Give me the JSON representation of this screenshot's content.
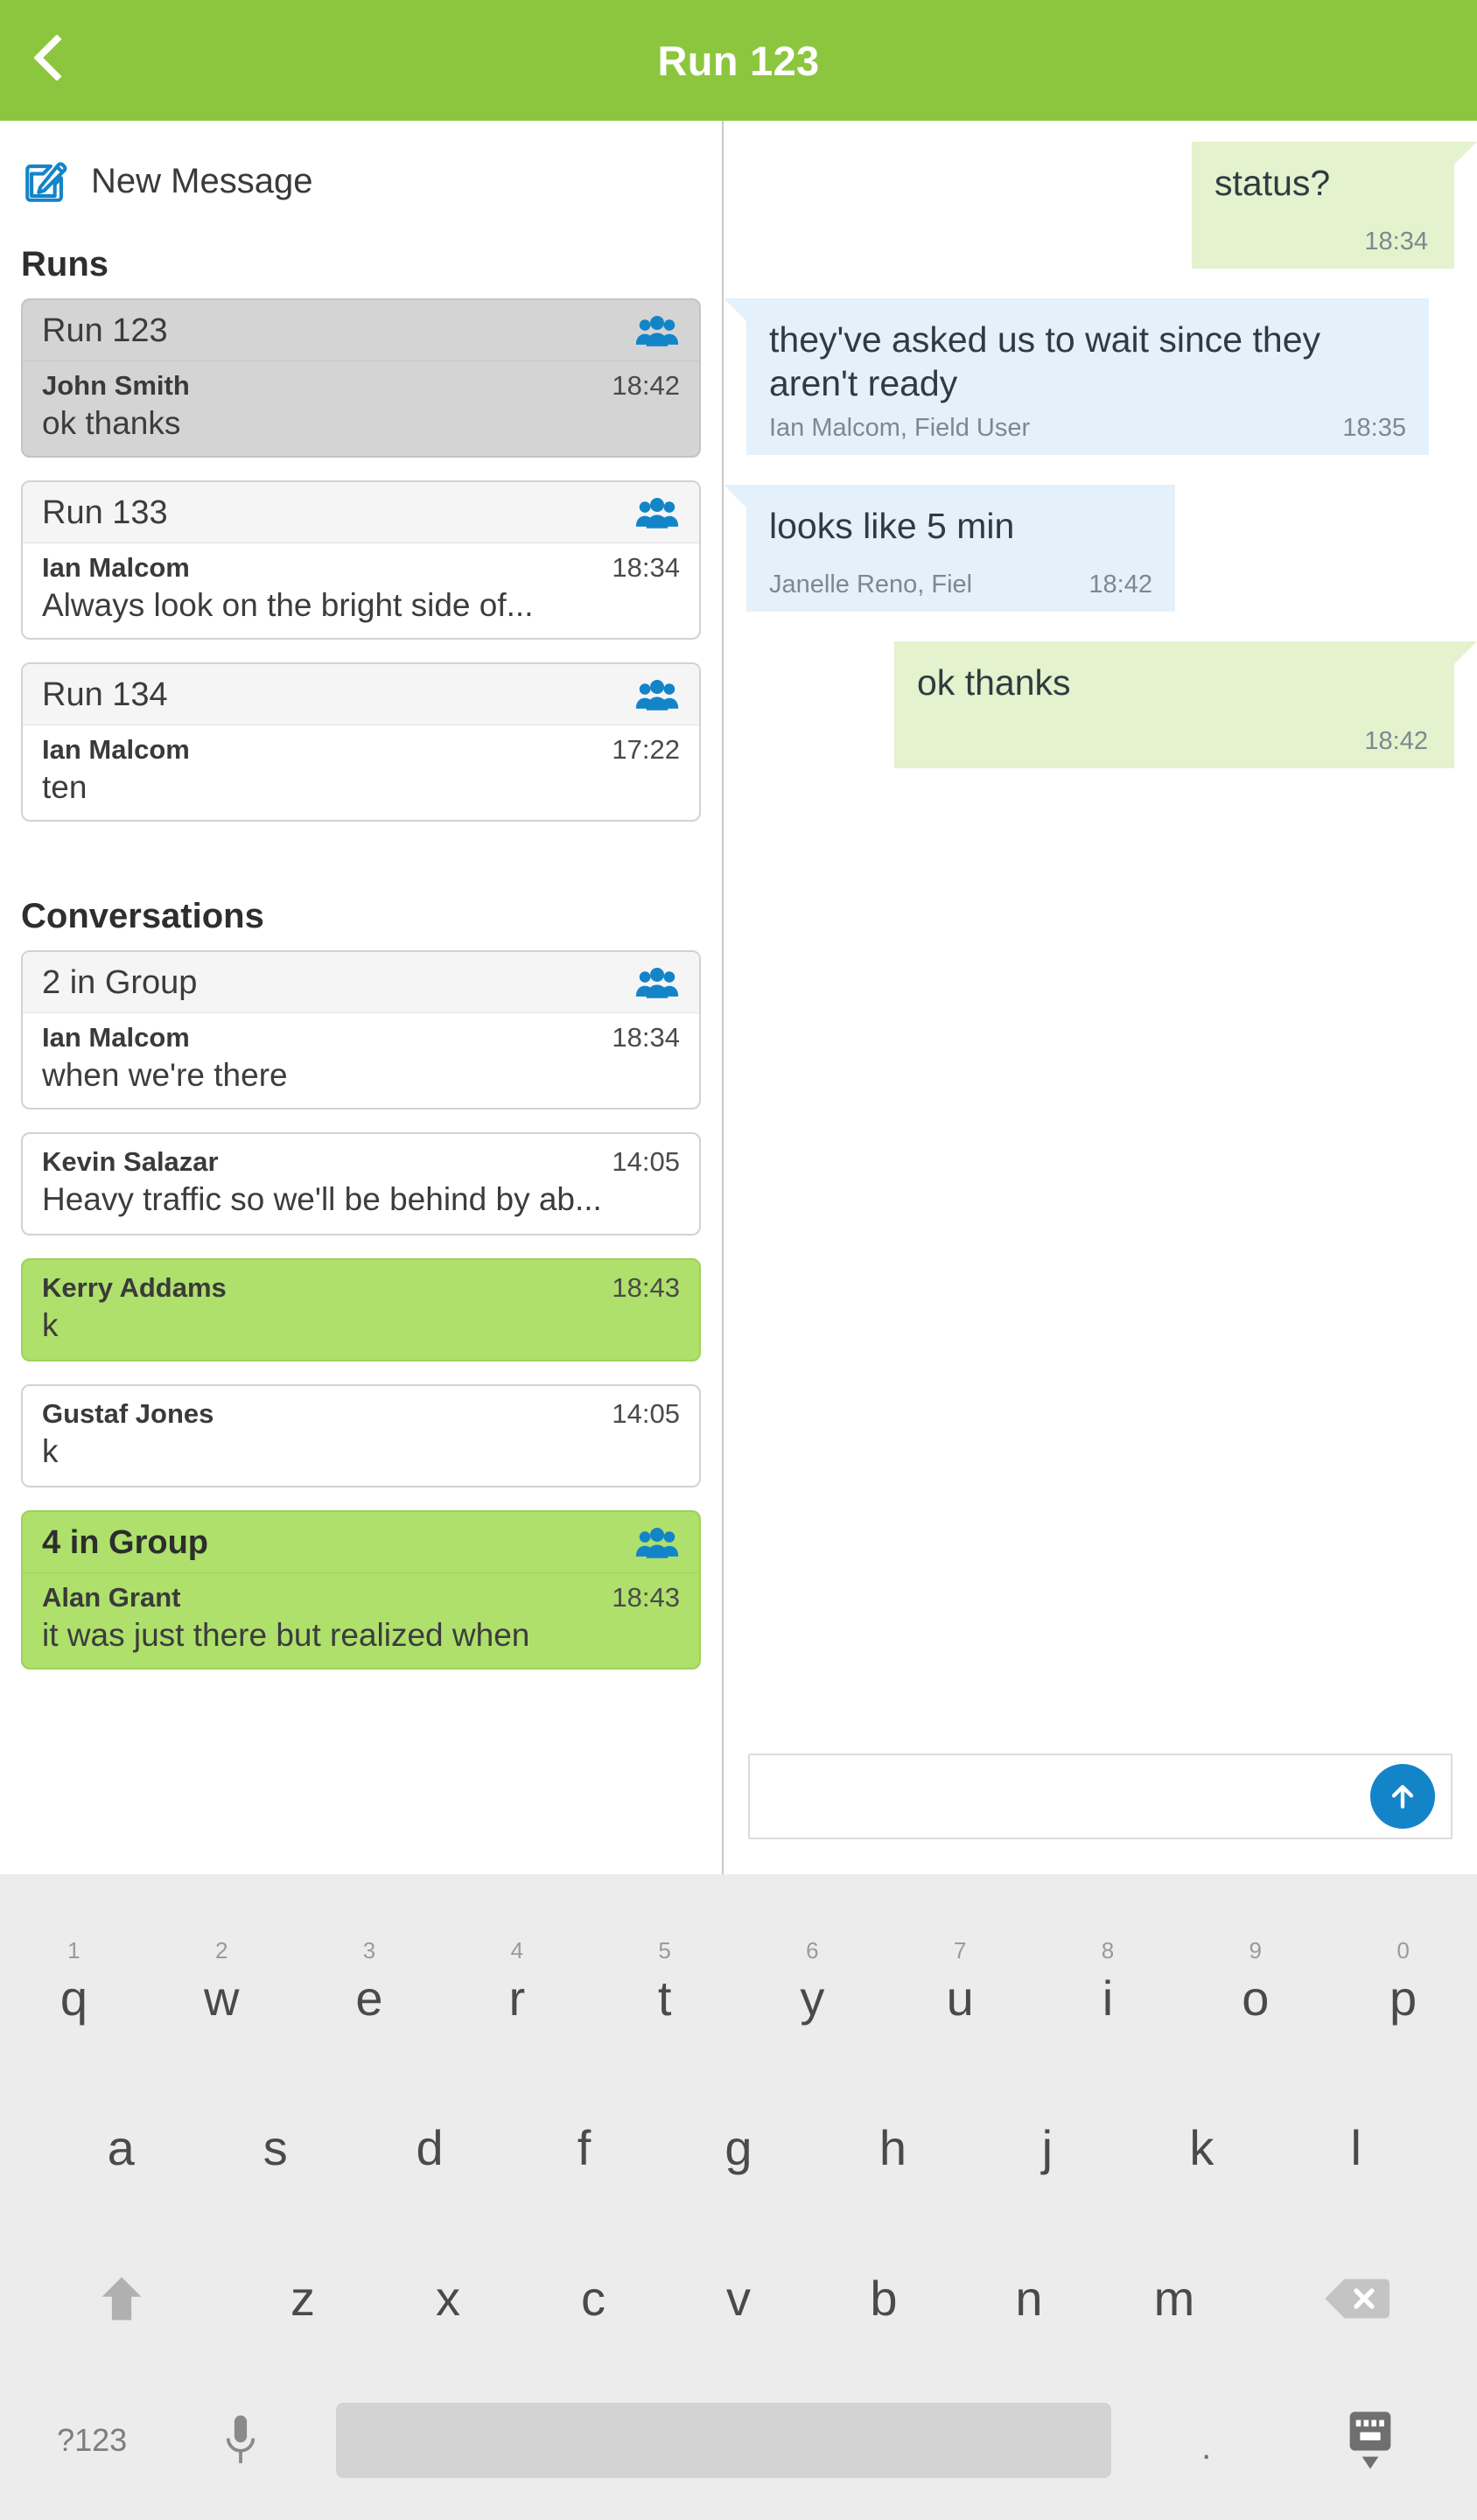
{
  "header": {
    "title": "Run 123",
    "back_icon": "chevron-left-icon",
    "bg_color": "#8CC63E"
  },
  "sidebar": {
    "new_message": {
      "label": "New Message",
      "icon": "compose-pencil-square-icon",
      "icon_color": "#1484c8"
    },
    "sections": [
      {
        "title": "Runs",
        "items": [
          {
            "title": "Run 123",
            "sender": "John Smith",
            "time": "18:42",
            "preview": "ok thanks",
            "group_icon": "group-people-icon",
            "state": "selected"
          },
          {
            "title": "Run 133",
            "sender": "Ian Malcom",
            "time": "18:34",
            "preview": "Always look on the bright side of...",
            "group_icon": "group-people-icon",
            "state": "normal"
          },
          {
            "title": "Run 134",
            "sender": "Ian Malcom",
            "time": "17:22",
            "preview": "ten",
            "group_icon": "group-people-icon",
            "state": "normal"
          }
        ]
      },
      {
        "title": "Conversations",
        "items": [
          {
            "title": "2 in Group",
            "sender": "Ian Malcom",
            "time": "18:34",
            "preview": "when we're there",
            "group_icon": "group-people-icon",
            "state": "normal"
          },
          {
            "title": null,
            "sender": "Kevin Salazar",
            "time": "14:05",
            "preview": "Heavy traffic so we'll be behind by ab...",
            "state": "normal"
          },
          {
            "title": null,
            "sender": "Kerry Addams",
            "time": "18:43",
            "preview": "k",
            "state": "unread"
          },
          {
            "title": null,
            "sender": "Gustaf Jones",
            "time": "14:05",
            "preview": "k",
            "state": "normal"
          },
          {
            "title": "4 in Group",
            "sender": "Alan Grant",
            "time": "18:43",
            "preview": "it was just there but realized when",
            "group_icon": "group-people-icon",
            "state": "unread"
          }
        ]
      }
    ]
  },
  "chat": {
    "messages": [
      {
        "direction": "out",
        "text": "status?",
        "sender": "",
        "time": "18:34",
        "bg_color": "#e4f2cd"
      },
      {
        "direction": "in",
        "text": "they've asked us to wait since they aren't ready",
        "sender": "Ian Malcom, Field User",
        "time": "18:35",
        "bg_color": "#e4f1fb"
      },
      {
        "direction": "in",
        "text": "looks like 5 min",
        "sender": "Janelle Reno, Fiel",
        "time": "18:42",
        "bg_color": "#e4f1fb"
      },
      {
        "direction": "out",
        "text": "ok thanks",
        "sender": "",
        "time": "18:42",
        "bg_color": "#e4f2cd"
      }
    ],
    "composer": {
      "value": "",
      "placeholder": "",
      "send_icon": "send-arrow-up-icon",
      "send_color": "#1484c8"
    }
  },
  "keyboard": {
    "row1": [
      {
        "num": "1",
        "letter": "q"
      },
      {
        "num": "2",
        "letter": "w"
      },
      {
        "num": "3",
        "letter": "e"
      },
      {
        "num": "4",
        "letter": "r"
      },
      {
        "num": "5",
        "letter": "t"
      },
      {
        "num": "6",
        "letter": "y"
      },
      {
        "num": "7",
        "letter": "u"
      },
      {
        "num": "8",
        "letter": "i"
      },
      {
        "num": "9",
        "letter": "o"
      },
      {
        "num": "0",
        "letter": "p"
      }
    ],
    "row2": [
      "a",
      "s",
      "d",
      "f",
      "g",
      "h",
      "j",
      "k",
      "l"
    ],
    "row3": [
      "z",
      "x",
      "c",
      "v",
      "b",
      "n",
      "m"
    ],
    "shift_icon": "shift-arrow-up-icon",
    "backspace_icon": "backspace-delete-icon",
    "symbols_label": "?123",
    "mic_icon": "microphone-icon",
    "space_label": "",
    "period_label": ".",
    "hide_keyboard_icon": "hide-keyboard-icon"
  }
}
